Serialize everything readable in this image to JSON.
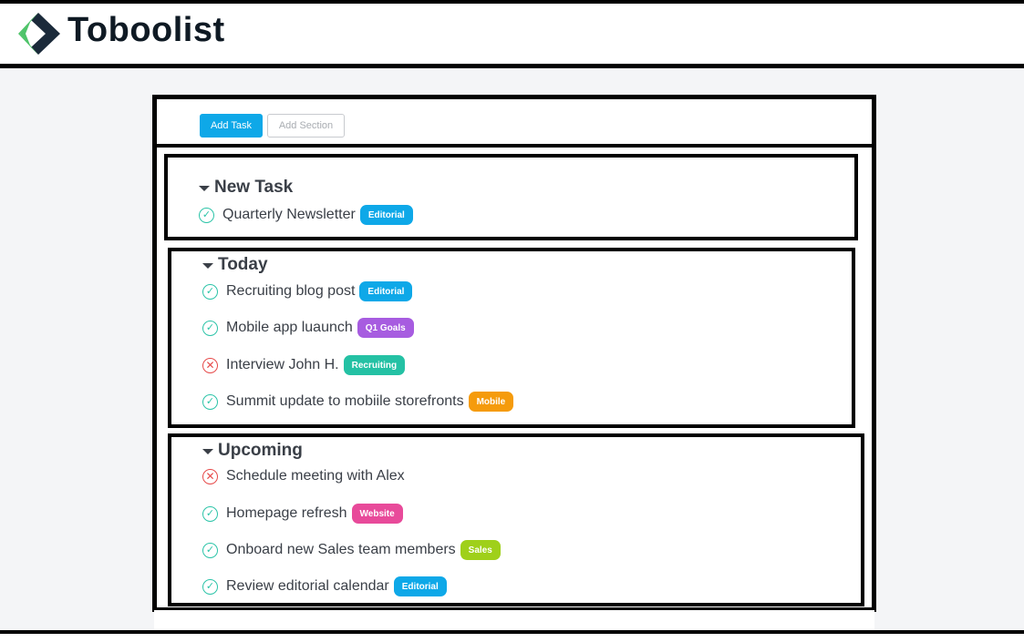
{
  "app": {
    "name": "Toboolist",
    "logo_icon": "diamond-chevron-icon",
    "colors": {
      "logo_green": "#4fc46a",
      "logo_dark": "#1b2a3a"
    }
  },
  "toolbar": {
    "add_task_label": "Add Task",
    "add_section_label": "Add Section"
  },
  "sections": [
    {
      "title": "New Task",
      "tasks": [
        {
          "label": "Quarterly Newsletter",
          "status": "done",
          "tag": "Editorial",
          "tag_color": "#0ea8e8"
        }
      ]
    },
    {
      "title": "Today",
      "tasks": [
        {
          "label": "Recruiting blog post",
          "status": "done",
          "tag": "Editorial",
          "tag_color": "#0ea8e8"
        },
        {
          "label": "Mobile app luaunch",
          "status": "done",
          "tag": "Q1 Goals",
          "tag_color": "#a75ce0"
        },
        {
          "label": "Interview John H.",
          "status": "failed",
          "tag": "Recruiting",
          "tag_color": "#24c1a4"
        },
        {
          "label": "Summit update to mobiile storefronts",
          "status": "done",
          "tag": "Mobile",
          "tag_color": "#f59b0c"
        }
      ]
    },
    {
      "title": "Upcoming",
      "tasks": [
        {
          "label": "Schedule meeting with Alex",
          "status": "failed",
          "tag": "",
          "tag_color": ""
        },
        {
          "label": "Homepage refresh",
          "status": "done",
          "tag": "Website",
          "tag_color": "#e84a9a"
        },
        {
          "label": "Onboard new Sales team members",
          "status": "done",
          "tag": "Sales",
          "tag_color": "#9fd01a"
        },
        {
          "label": "Review editorial calendar",
          "status": "done",
          "tag": "Editorial",
          "tag_color": "#0ea8e8"
        }
      ]
    }
  ]
}
